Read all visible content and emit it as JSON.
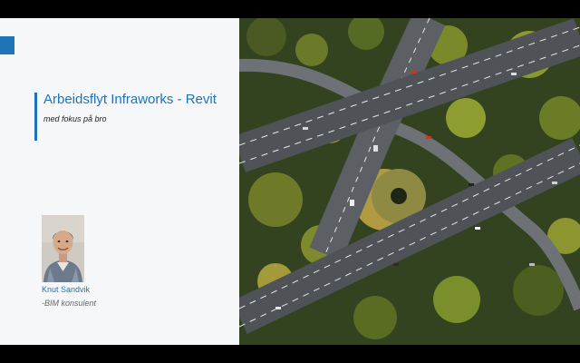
{
  "slide": {
    "title": "Arbeidsflyt Infraworks - Revit",
    "subtitle": "med fokus på bro",
    "presenter": {
      "name": "Knut Sandvik",
      "role": "-BIM konsulent"
    }
  },
  "colors": {
    "accent": "#1f73b7",
    "panel_background": "#f6f7f9",
    "frame": "#000000"
  },
  "icons": {
    "corner_mark": "blue-square-mark",
    "photo": "person-portrait",
    "image": "highway-interchange-aerial"
  }
}
